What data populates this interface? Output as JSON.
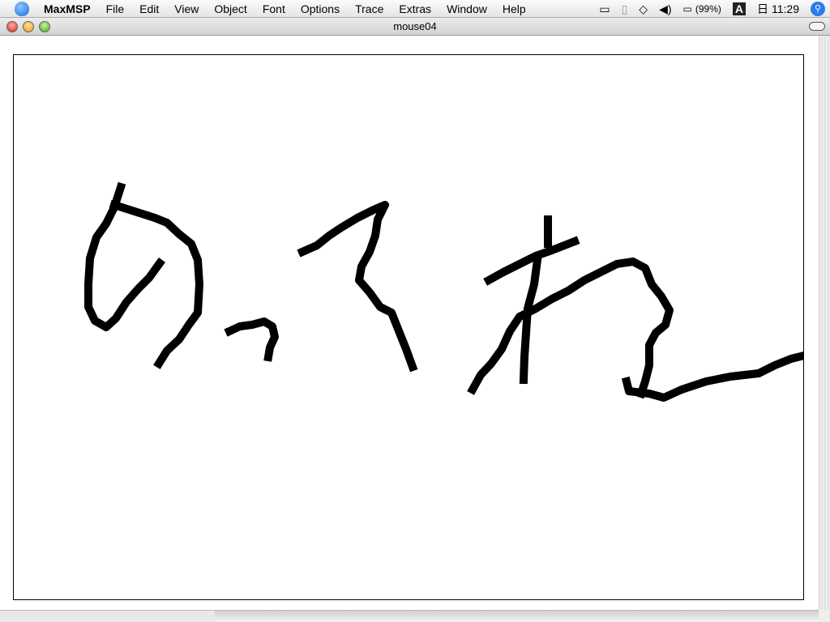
{
  "menubar": {
    "app": "MaxMSP",
    "items": [
      "File",
      "Edit",
      "View",
      "Object",
      "Font",
      "Options",
      "Trace",
      "Extras",
      "Window",
      "Help"
    ],
    "battery": "(99%)",
    "input_method": "A",
    "day": "日",
    "time": "11:29"
  },
  "window": {
    "title": "mouse04"
  }
}
